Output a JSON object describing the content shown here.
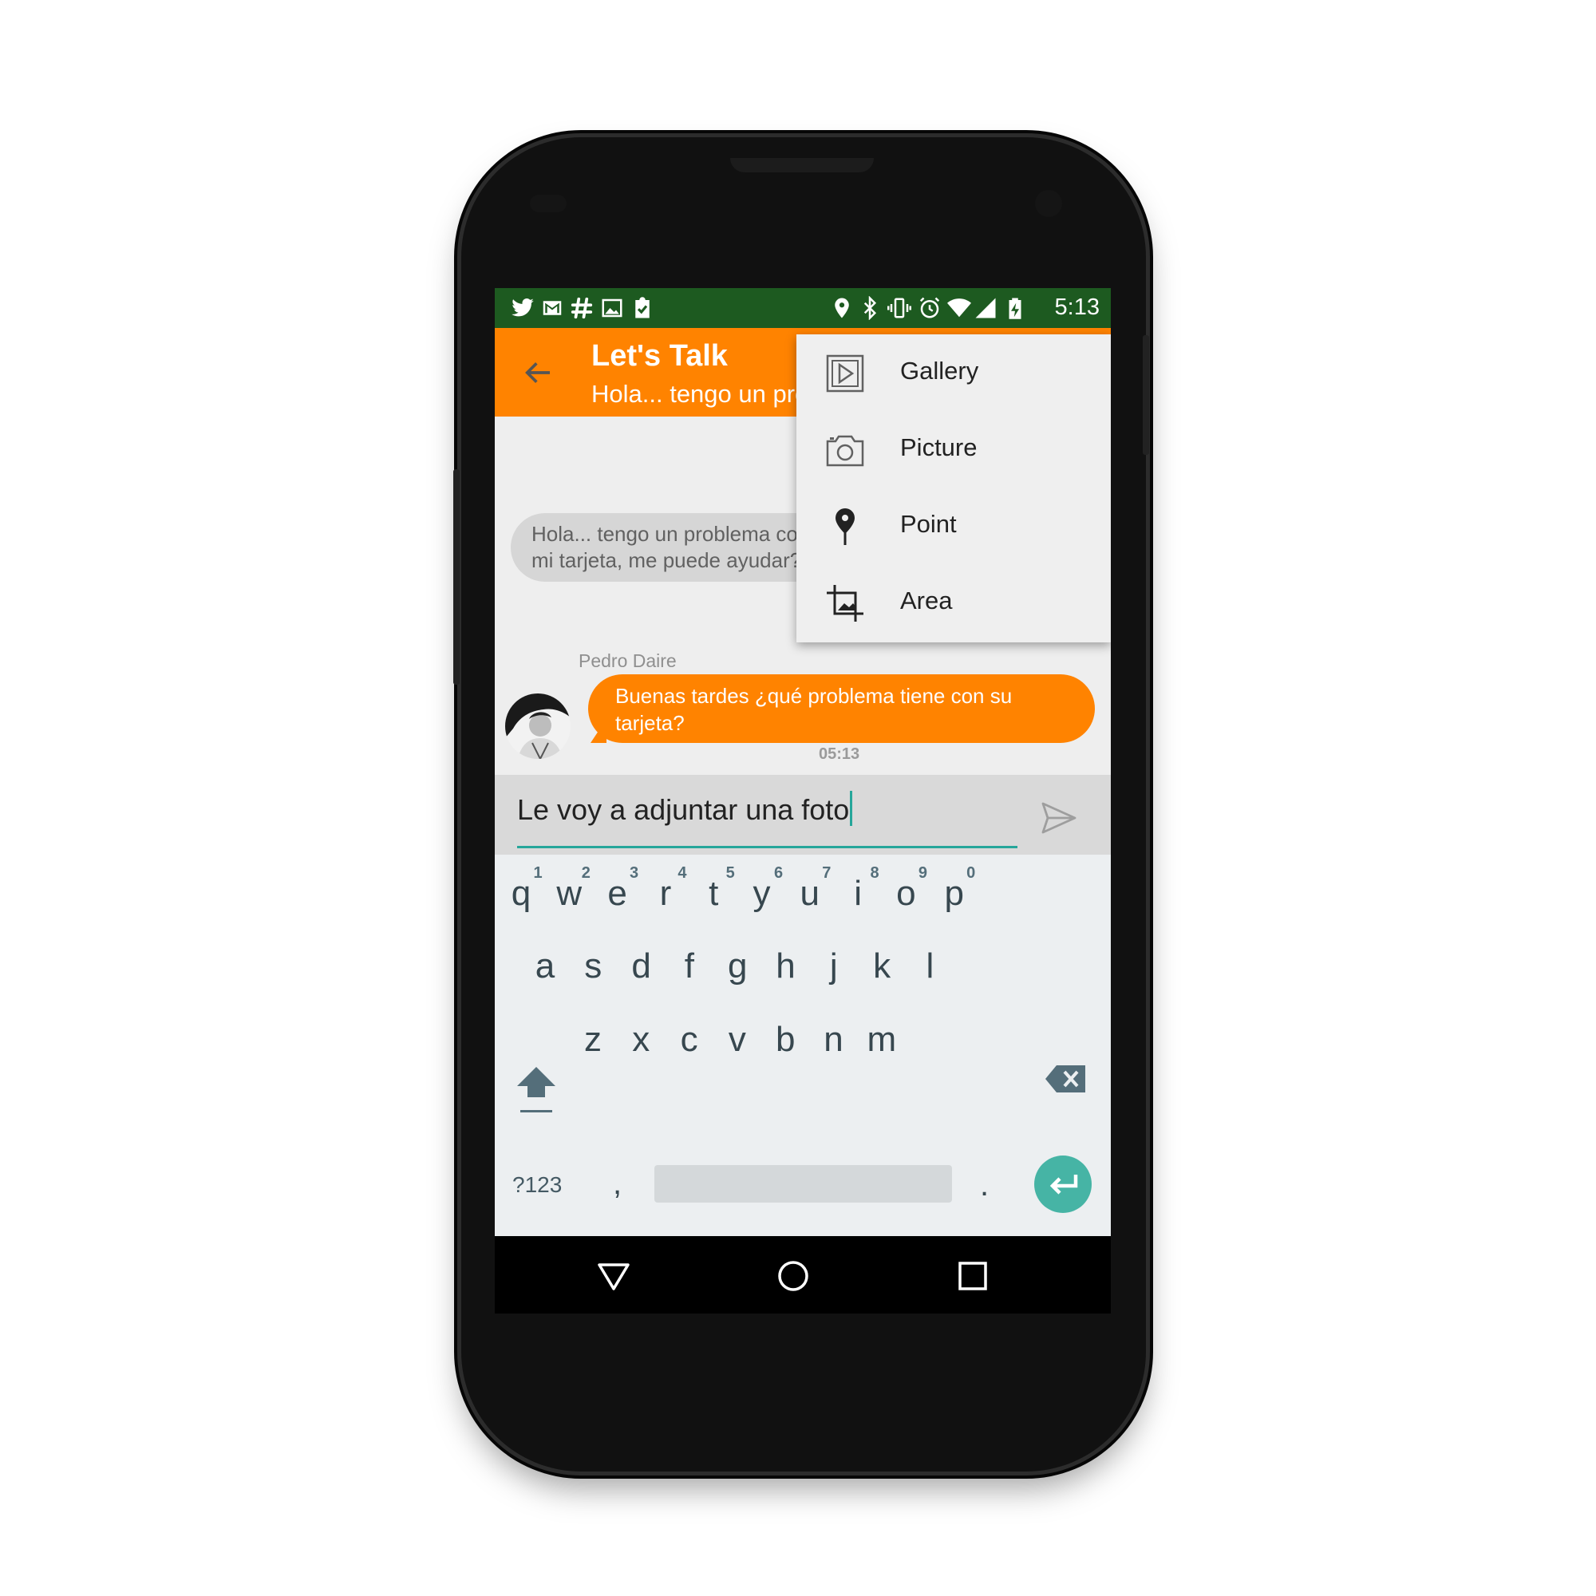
{
  "status_bar": {
    "time": "5:13",
    "left_icons": [
      "twitter-icon",
      "gmail-icon",
      "slack-icon",
      "image-icon",
      "clipboard-check-icon"
    ],
    "right_icons": [
      "location-icon",
      "bluetooth-icon",
      "vibrate-icon",
      "alarm-icon",
      "wifi-icon",
      "signal-icon",
      "battery-charging-icon"
    ]
  },
  "app_bar": {
    "title": "Let's Talk",
    "subtitle": "Hola... tengo un problema con mi tarjeta, me puede ayudar??"
  },
  "messages": {
    "incoming": {
      "text": "Hola... tengo un problema con mi tarjeta, me puede ayudar??"
    },
    "outgoing": {
      "sender": "Pedro Daire",
      "text": "Buenas tardes ¿qué problema tiene con su tarjeta?",
      "time": "05:13"
    }
  },
  "composer": {
    "text": "Le voy a adjuntar una foto",
    "send_icon": "send-icon",
    "accent": "#26a69a"
  },
  "menu": {
    "items": [
      {
        "label": "Gallery",
        "icon": "gallery-icon"
      },
      {
        "label": "Picture",
        "icon": "camera-icon"
      },
      {
        "label": "Point",
        "icon": "map-pin-icon"
      },
      {
        "label": "Area",
        "icon": "crop-icon"
      }
    ]
  },
  "keyboard": {
    "row1": [
      "q",
      "w",
      "e",
      "r",
      "t",
      "y",
      "u",
      "i",
      "o",
      "p"
    ],
    "row1_hints": [
      "1",
      "2",
      "3",
      "4",
      "5",
      "6",
      "7",
      "8",
      "9",
      "0"
    ],
    "row2": [
      "a",
      "s",
      "d",
      "f",
      "g",
      "h",
      "j",
      "k",
      "l"
    ],
    "row3": [
      "z",
      "x",
      "c",
      "v",
      "b",
      "n",
      "m"
    ],
    "symbols": "?123",
    "comma": ",",
    "period": "."
  },
  "colors": {
    "status_bar": "#1d5a20",
    "app_bar": "#ff8300",
    "outgoing_bubble": "#ff8300",
    "incoming_bubble": "#d6d6d6",
    "enter_key": "#46b4a5"
  }
}
